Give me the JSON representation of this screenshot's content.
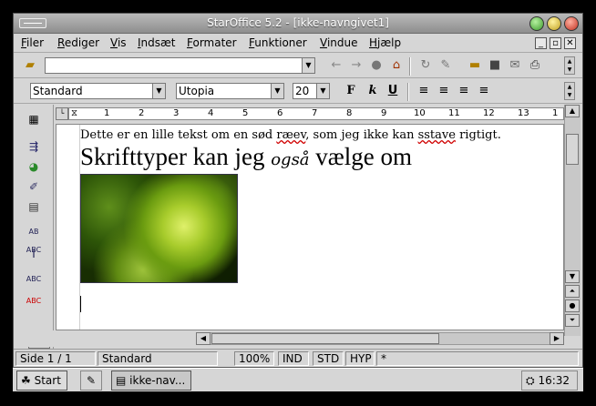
{
  "window": {
    "title": "StarOffice 5.2 - [ikke-navngivet1]"
  },
  "menubar": {
    "items": [
      {
        "label": "Filer"
      },
      {
        "label": "Rediger"
      },
      {
        "label": "Vis"
      },
      {
        "label": "Indsæt"
      },
      {
        "label": "Formater"
      },
      {
        "label": "Funktioner"
      },
      {
        "label": "Vindue"
      },
      {
        "label": "Hjælp"
      }
    ]
  },
  "toolbar": {
    "url_value": "",
    "paragraph_style": "Standard",
    "font_name": "Utopia",
    "font_size": "20",
    "bold_label": "F",
    "italic_label": "k",
    "underline_label": "U"
  },
  "ruler": {
    "ticks": [
      "1",
      "2",
      "3",
      "4",
      "5",
      "6",
      "7",
      "8",
      "9",
      "10",
      "11",
      "12",
      "13",
      "1"
    ]
  },
  "document": {
    "line1_a": "Dette er en lille tekst om en sød ",
    "line1_err1": "ræev",
    "line1_b": ", som jeg ikke kan ",
    "line1_err2": "sstave",
    "line1_c": " rigtigt.",
    "line2_a": "Skrifttyper kan jeg ",
    "line2_script": "også",
    "line2_b": " vælge om"
  },
  "statusbar": {
    "page": "Side 1 / 1",
    "style": "Standard",
    "zoom": "100%",
    "mode_ind": "IND",
    "mode_std": "STD",
    "mode_hyp": "HYP",
    "modified": "*"
  },
  "taskbar": {
    "start_label": "Start",
    "app_label": "ikke-nav...",
    "clock": "16:32"
  },
  "colors": {
    "titlebar": "#8e8e8e",
    "spellcheck_error": "#d00000"
  }
}
